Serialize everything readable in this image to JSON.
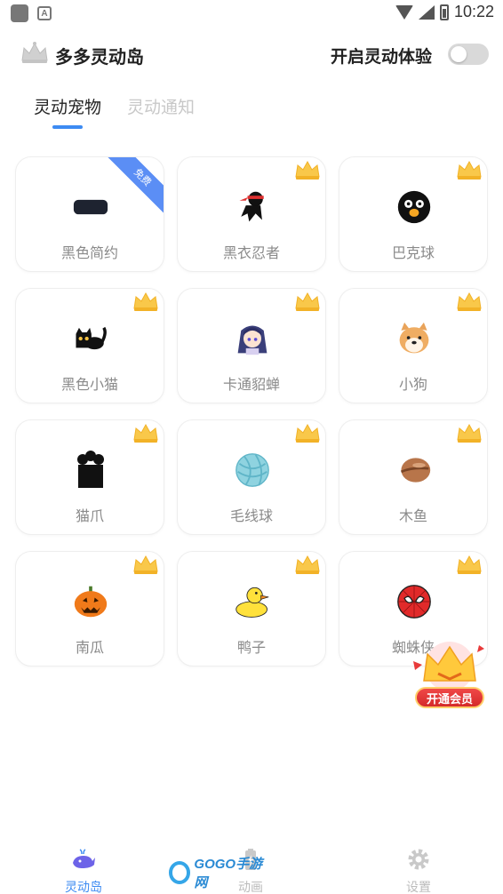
{
  "status_bar": {
    "time": "10:22",
    "left_icons": [
      "app-square-icon",
      "a-letter-icon"
    ],
    "right_icons": [
      "wifi-icon",
      "signal-icon",
      "battery-icon"
    ]
  },
  "header": {
    "title": "多多灵动岛",
    "toggle_label": "开启灵动体验",
    "toggle_on": false,
    "logo_icon": "crown-icon"
  },
  "tabs": [
    {
      "label": "灵动宠物",
      "active": true
    },
    {
      "label": "灵动通知",
      "active": false
    }
  ],
  "accent_color": "#3d8bf2",
  "pets": [
    {
      "name": "黑色简约",
      "icon": "black-pill-icon",
      "badge": "免费"
    },
    {
      "name": "黑衣忍者",
      "icon": "ninja-icon",
      "badge": "vip-crown"
    },
    {
      "name": "巴克球",
      "icon": "bakeball-icon",
      "badge": "vip-crown"
    },
    {
      "name": "黑色小猫",
      "icon": "black-cat-icon",
      "badge": "vip-crown"
    },
    {
      "name": "卡通貂蝉",
      "icon": "cartoon-girl-icon",
      "badge": "vip-crown"
    },
    {
      "name": "小狗",
      "icon": "shiba-dog-icon",
      "badge": "vip-crown"
    },
    {
      "name": "猫爪",
      "icon": "cat-paw-icon",
      "badge": "vip-crown"
    },
    {
      "name": "毛线球",
      "icon": "yarn-ball-icon",
      "badge": "vip-crown"
    },
    {
      "name": "木鱼",
      "icon": "wooden-fish-icon",
      "badge": "vip-crown"
    },
    {
      "name": "南瓜",
      "icon": "pumpkin-icon",
      "badge": "vip-crown"
    },
    {
      "name": "鸭子",
      "icon": "duck-icon",
      "badge": "vip-crown"
    },
    {
      "name": "蜘蛛侠",
      "icon": "spiderman-icon",
      "badge": "vip-crown"
    }
  ],
  "vip_float": {
    "label": "开通会员",
    "icon": "vip-crown-icon"
  },
  "bottom_nav": [
    {
      "label": "灵动岛",
      "icon": "whale-icon",
      "active": true
    },
    {
      "label": "动画",
      "icon": "battery-animation-icon",
      "active": false
    },
    {
      "label": "设置",
      "icon": "gear-icon",
      "active": false
    }
  ],
  "watermark": {
    "text": "GOGO手游网"
  }
}
